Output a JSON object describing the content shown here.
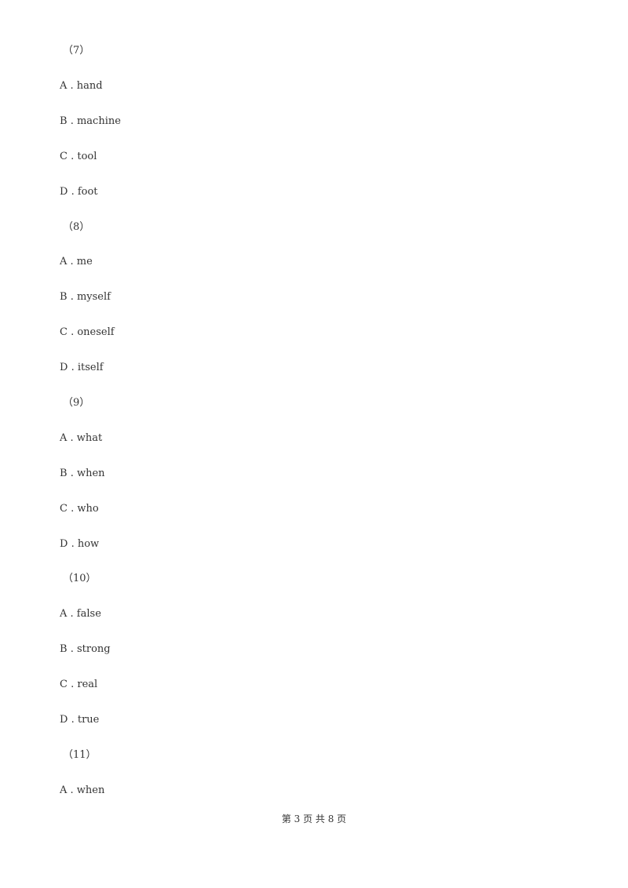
{
  "questions": [
    {
      "number": "（7）",
      "options": [
        {
          "letter": "A",
          "text": "hand"
        },
        {
          "letter": "B",
          "text": "machine"
        },
        {
          "letter": "C",
          "text": "tool"
        },
        {
          "letter": "D",
          "text": "foot"
        }
      ]
    },
    {
      "number": "（8）",
      "options": [
        {
          "letter": "A",
          "text": "me"
        },
        {
          "letter": "B",
          "text": "myself"
        },
        {
          "letter": "C",
          "text": "oneself"
        },
        {
          "letter": "D",
          "text": "itself"
        }
      ]
    },
    {
      "number": "（9）",
      "options": [
        {
          "letter": "A",
          "text": "what"
        },
        {
          "letter": "B",
          "text": "when"
        },
        {
          "letter": "C",
          "text": "who"
        },
        {
          "letter": "D",
          "text": "how"
        }
      ]
    },
    {
      "number": "（10）",
      "options": [
        {
          "letter": "A",
          "text": "false"
        },
        {
          "letter": "B",
          "text": "strong"
        },
        {
          "letter": "C",
          "text": "real"
        },
        {
          "letter": "D",
          "text": "true"
        }
      ]
    },
    {
      "number": "（11）",
      "options": [
        {
          "letter": "A",
          "text": "when"
        }
      ]
    }
  ],
  "footer": {
    "text": "第 3 页 共 8 页"
  }
}
